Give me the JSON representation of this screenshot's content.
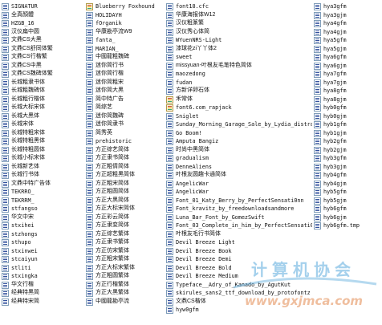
{
  "columns": [
    [
      "SIGNATUR",
      "全真顏體",
      "HZGB_16",
      "汉仪扁中圆",
      "文鼎CS大黑",
      "文鼎CS舒同体繁",
      "文鼎CS行楷繁",
      "文鼎CS中黑",
      "文鼎CS魏碑体繁",
      "长城粗隶书体",
      "长城粗魏碑体",
      "长城粗行楷体",
      "长城大标宋体",
      "长城大黑体",
      "长城宋体",
      "长城特粗宋体",
      "长城特粗黑体",
      "长城特粗圆体",
      "长城小标宋体",
      "长城新艺体",
      "长城行书体",
      "文鼎中特广告体",
      "TEKRRO_",
      "TEKRRM_",
      "stfangso",
      "华文中宋",
      "stxihei",
      "stzhongs",
      "sthupo",
      "stxinwei",
      "stcaiyun",
      "stliti",
      "stxingka",
      "华文行楷",
      "经典特黑简",
      "经典特宋简"
    ],
    [
      "Blueberry Foxhound",
      "HOLIDAYH",
      "fOrganik",
      "华康勘亭流W9",
      "fanta_",
      "MARIAN_",
      "中國龍粗魏碑",
      "迷你简行书",
      "迷你简行楷",
      "迷你简粗宋",
      "迷你简大黑",
      "简中特广告",
      "简综艺",
      "迷你简魏碑",
      "迷你简隶书",
      "简秀英",
      "prehistoric",
      "方正综艺简体",
      "方正隶书简体",
      "方正粗倩简体",
      "方正超粗黑简体",
      "方正粗宋简体",
      "方正粗圆简体",
      "方正大黑简体",
      "方正大标宋简体",
      "方正彩云简体",
      "方正隶变简体",
      "方正综艺繁体",
      "方正隶书繁体",
      "方正仿宋繁体",
      "方正粗宋繁体",
      "方正大标宋繁体",
      "方正粗圆繁体",
      "方正行楷繁体",
      "方正大黑繁体",
      "中國龍勘亭流"
    ],
    [
      "font18.cfc",
      "华康海报体W12",
      "汉仪粗篆繁",
      "汉仪秀心体简",
      "WYuenNRS-Light",
      "漆球花zi丫丫体2",
      "sweet",
      "missyuan-叶根友毛笔特色简体",
      "maozedong",
      "fudan",
      "方新详卵石体",
      "禾常体",
      "font6.com_rapjack",
      "Sniglet",
      "Sunday_Morning_Garage_Sale_by_Lydia_distracted",
      "Go Boom!",
      "Amputa Bangiz",
      "时尚中黑简体",
      "gradualism",
      "DenneAliens",
      "叶根友圆趣卡通简体",
      "AngelicWar",
      "AngelicWar",
      "Font_01_Katy_Berry_by_PerfectSensati0nn",
      "Font_kravitz_by_freedownloadsandmore",
      "Luna_Bar_Font_by_GomezSwift",
      "Font_03_Complete_in_him_by_PerfectSensati0nn",
      "叶根友毛行书简体",
      "Devil Breeze Light",
      "Devil Breeze Book",
      "Devil Breeze Demi",
      "Devil Breeze Bold",
      "Devil Breeze Medium",
      "Typeface__Adry_of_Kanado_by_AgutKut",
      "skirules_sans2_ttf_download_by_protofontz",
      "文鼎CS楷体",
      "hyw0gfm"
    ],
    [
      "hya3gfm",
      "hya3gjm",
      "hya4gfm",
      "hya4gjm",
      "hya5gfm",
      "hya5gjm",
      "hya6gfm",
      "hya6gjm",
      "hya7gfm",
      "hya7gjm",
      "hya8gfm",
      "hya8gjm",
      "hyb0gfm",
      "hyb0gjm",
      "hyb1gfm",
      "hyb1gjm",
      "hyb2gfm",
      "hyb2gjm",
      "hyb3gfm",
      "hyb3gjm",
      "hyb4gfm",
      "hyb4gjm",
      "hyb5gfm",
      "hyb5gjm",
      "hyb6gfm",
      "hyb6gjm",
      "hyb6gfm.tmp"
    ]
  ],
  "watermark": {
    "title": "计算机协会",
    "url": "www.gxjmca.com"
  }
}
